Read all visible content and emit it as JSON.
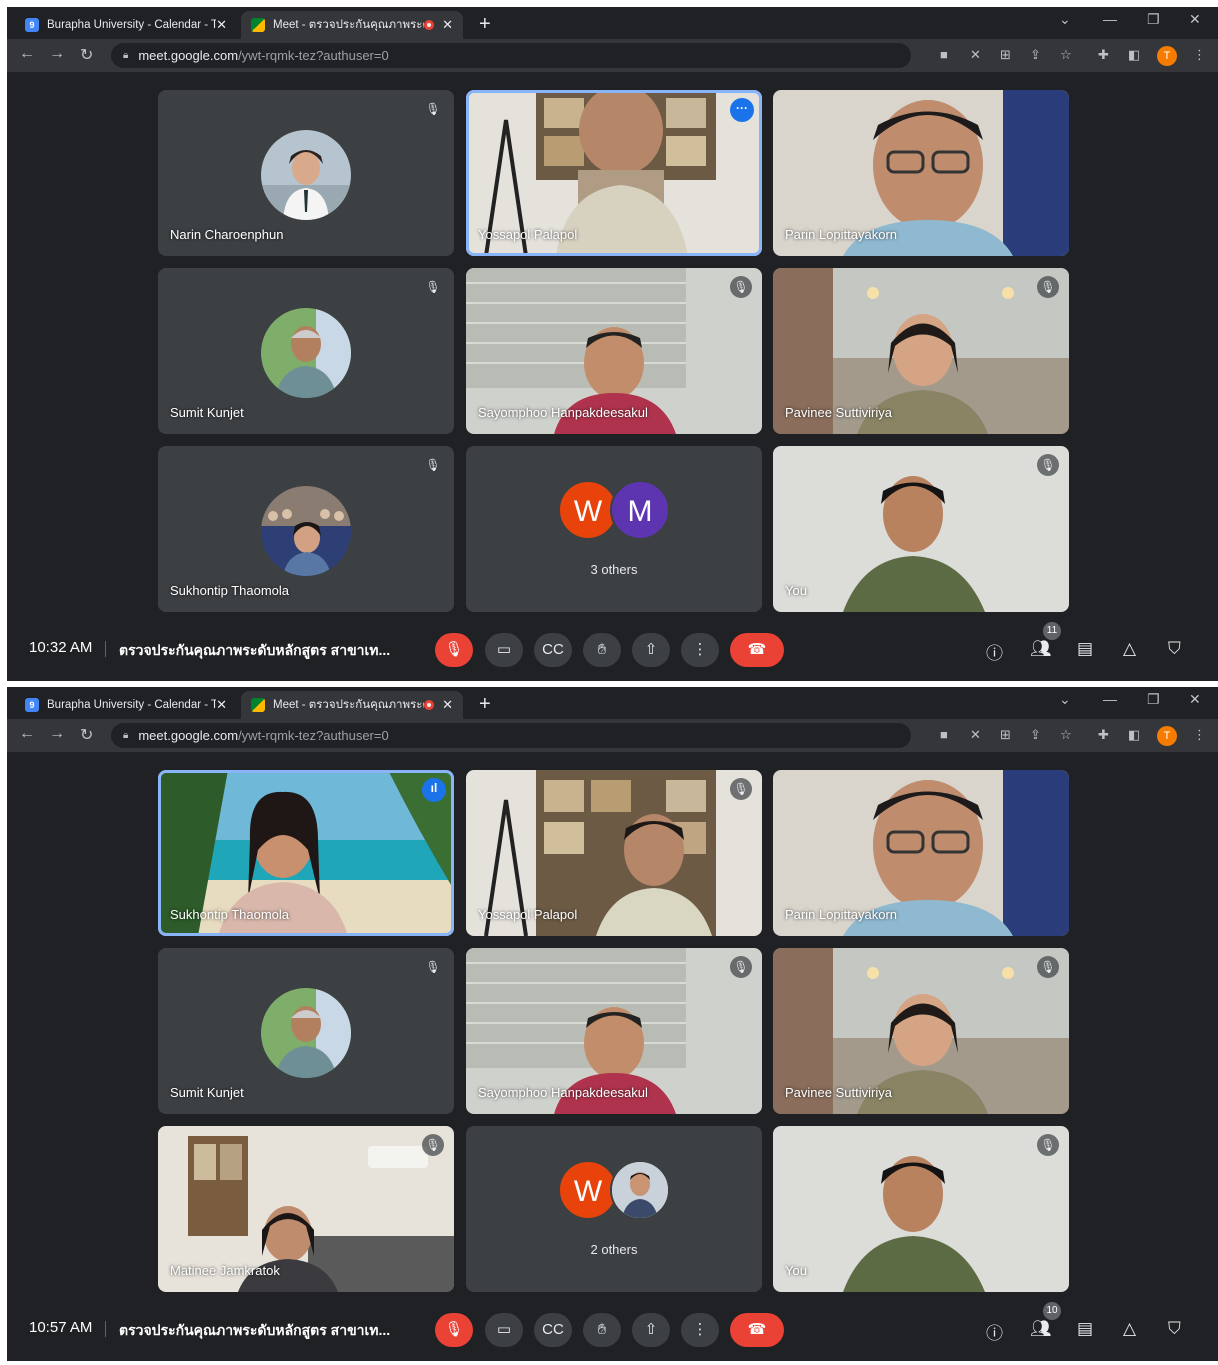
{
  "browser": {
    "tabs": [
      {
        "title": "Burapha University - Calendar - T"
      },
      {
        "title": "Meet - ตรวจประกันคุณภาพระดั"
      }
    ],
    "new_tab": "+",
    "url_host": "meet.google.com",
    "url_path": "/ywt-rqmk-tez?authuser=0",
    "profile_initial": "T"
  },
  "meeting_title": "ตรวจประกันคุณภาพระดับหลักสูตร สาขาเท...",
  "screens": [
    {
      "time": "10:32 AM",
      "participant_count": "11",
      "tiles": [
        {
          "name": "Narin Charoenphun"
        },
        {
          "name": "Yossapol Palapol"
        },
        {
          "name": "Parin Lopittayakorn"
        },
        {
          "name": "Sumit Kunjet"
        },
        {
          "name": "Sayomphoo Hanpakdeesakul"
        },
        {
          "name": "Pavinee Suttiviriya"
        },
        {
          "name": "Sukhontip Thaomola"
        },
        {
          "initials": [
            "W",
            "M"
          ],
          "label": "3 others"
        },
        {
          "name": "You"
        }
      ]
    },
    {
      "time": "10:57 AM",
      "participant_count": "10",
      "tiles": [
        {
          "name": "Sukhontip Thaomola"
        },
        {
          "name": "Yossapol Palapol"
        },
        {
          "name": "Parin Lopittayakorn"
        },
        {
          "name": "Sumit Kunjet"
        },
        {
          "name": "Sayomphoo Hanpakdeesakul"
        },
        {
          "name": "Pavinee Suttiviriya"
        },
        {
          "name": "Matinee Jamkratok"
        },
        {
          "initials": [
            "W"
          ],
          "label": "2 others"
        },
        {
          "name": "You"
        }
      ]
    }
  ],
  "colors": {
    "accent": "#8ab4f8",
    "end_call": "#ea4335",
    "tile_bg": "#3c4043",
    "stage_bg": "#202124"
  }
}
